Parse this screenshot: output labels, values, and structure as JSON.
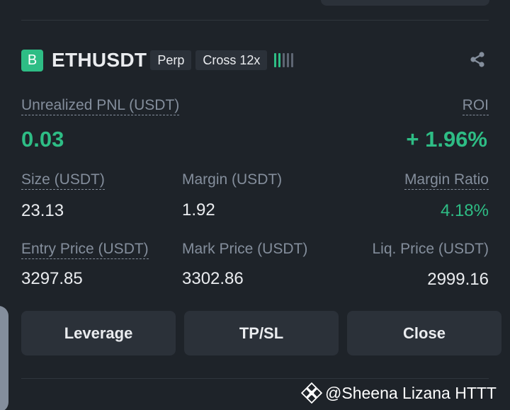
{
  "position": {
    "badge": "B",
    "symbol": "ETHUSDT",
    "type_tag": "Perp",
    "margin_tag": "Cross 12x",
    "risk_level": {
      "filled": 2,
      "total": 5
    },
    "share_icon": "share-icon"
  },
  "pnl": {
    "label": "Unrealized PNL (USDT)",
    "value": "0.03",
    "roi_label": "ROI",
    "roi_value": "+ 1.96%"
  },
  "stats": {
    "size_label": "Size (USDT)",
    "size_value": "23.13",
    "margin_label": "Margin (USDT)",
    "margin_value": "1.92",
    "margin_ratio_label": "Margin Ratio",
    "margin_ratio_value": "4.18%",
    "entry_label": "Entry Price (USDT)",
    "entry_value": "3297.85",
    "mark_label": "Mark Price (USDT)",
    "mark_value": "3302.86",
    "liq_label": "Liq. Price (USDT)",
    "liq_value": "2999.16"
  },
  "actions": {
    "leverage_label": "Leverage",
    "tpsl_label": "TP/SL",
    "close_label": "Close"
  },
  "watermark": {
    "text": "@Sheena Lizana HTTT",
    "icon": "binance-logo-icon"
  },
  "colors": {
    "background": "#1e2329",
    "panel": "#2b3139",
    "positive": "#2ebd85",
    "muted": "#848e9c",
    "text": "#eaecef"
  }
}
